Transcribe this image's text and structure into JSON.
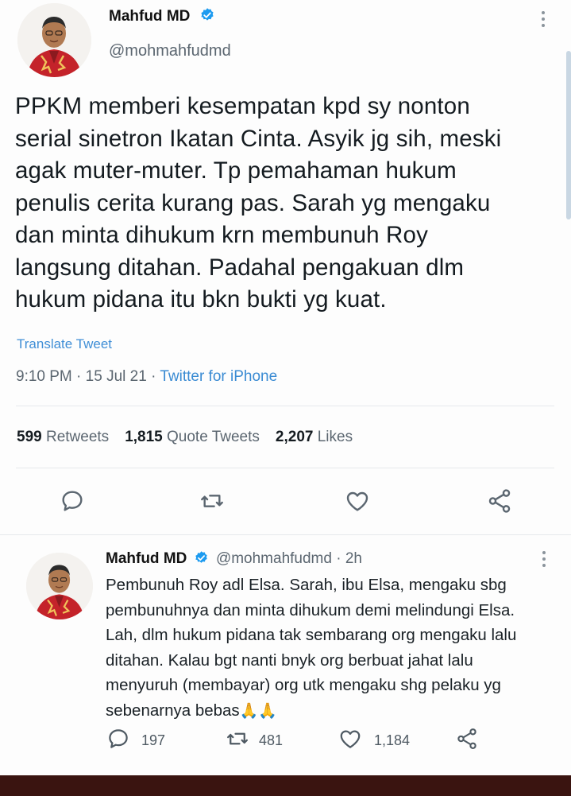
{
  "main_tweet": {
    "author_name": "Mahfud MD",
    "author_handle": "@mohmahfudmd",
    "text": "PPKM memberi kesempatan kpd sy nonton\nserial sinetron Ikatan Cinta. Asyik jg sih, meski\nagak muter-muter. Tp pemahaman hukum\npenulis cerita kurang pas. Sarah yg mengaku\ndan minta dihukum krn membunuh Roy\nlangsung ditahan. Padahal pengakuan dlm\nhukum pidana itu bkn bukti yg kuat.",
    "translate_label": "Translate Tweet",
    "time": "9:10 PM",
    "date": "15 Jul 21",
    "source": "Twitter for iPhone",
    "separator": "·",
    "stats": {
      "retweets_count": "599",
      "retweets_label": "Retweets",
      "quotes_count": "1,815",
      "quotes_label": "Quote Tweets",
      "likes_count": "2,207",
      "likes_label": "Likes"
    }
  },
  "reply_tweet": {
    "author_name": "Mahfud MD",
    "author_handle": "@mohmahfudmd",
    "age": "· 2h",
    "text": "Pembunuh Roy adl Elsa. Sarah, ibu Elsa, mengaku sbg\npembunuhnya dan minta dihukum demi melindungi Elsa.\nLah, dlm hukum pidana tak sembarang org mengaku lalu\nditahan. Kalau bgt nanti bnyk org berbuat jahat lalu\nmenyuruh (membayar) org utk mengaku shg pelaku yg\nsebenarnya bebas",
    "emoji": "🙏🙏",
    "replies": "197",
    "retweets": "481",
    "likes": "1,184"
  },
  "icons": {
    "verified": "verified-badge-icon",
    "reply": "reply-icon",
    "retweet": "retweet-icon",
    "like": "heart-icon",
    "share": "share-icon",
    "more": "more-dots-icon"
  },
  "colors": {
    "accent": "#1d9bf0",
    "link": "#3f8ed6",
    "muted": "#5b6670",
    "text": "#141b20"
  }
}
